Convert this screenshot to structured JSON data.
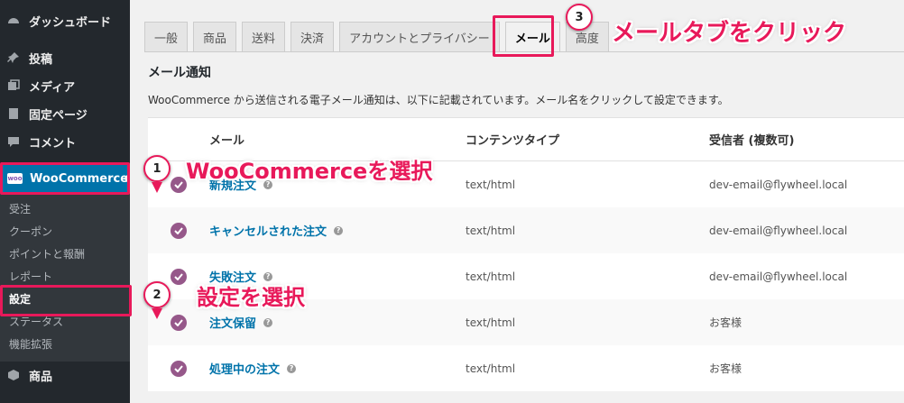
{
  "sidebar": {
    "items": [
      {
        "label": "ダッシュボード",
        "icon": "dashboard-icon"
      },
      {
        "label": "投稿",
        "icon": "pin-icon"
      },
      {
        "label": "メディア",
        "icon": "media-icon"
      },
      {
        "label": "固定ページ",
        "icon": "page-icon"
      },
      {
        "label": "コメント",
        "icon": "comment-icon"
      }
    ],
    "woocommerce": {
      "label": "WooCommerce",
      "logo_text": "woo"
    },
    "submenu": [
      "受注",
      "クーポン",
      "ポイントと報酬",
      "レポート",
      "設定",
      "ステータス",
      "機能拡張"
    ],
    "products": {
      "label": "商品",
      "icon": "products-icon"
    }
  },
  "tabs": [
    "一般",
    "商品",
    "送料",
    "決済",
    "アカウントとプライバシー",
    "メール",
    "高度"
  ],
  "active_tab": "メール",
  "section_title": "メール通知",
  "description": "WooCommerce から送信される電子メール通知は、以下に記載されています。メール名をクリックして設定できます。",
  "table": {
    "headers": [
      "メール",
      "コンテンツタイプ",
      "受信者 (複数可)"
    ],
    "rows": [
      {
        "name": "新規注文",
        "type": "text/html",
        "recipient": "dev-email@flywheel.local"
      },
      {
        "name": "キャンセルされた注文",
        "type": "text/html",
        "recipient": "dev-email@flywheel.local"
      },
      {
        "name": "失敗注文",
        "type": "text/html",
        "recipient": "dev-email@flywheel.local"
      },
      {
        "name": "注文保留",
        "type": "text/html",
        "recipient": "お客様"
      },
      {
        "name": "処理中の注文",
        "type": "text/html",
        "recipient": "お客様"
      }
    ],
    "help_glyph": "?"
  },
  "annotations": {
    "step1": {
      "number": "1",
      "text": "WooCommerceを選択"
    },
    "step2": {
      "number": "2",
      "text": "設定を選択"
    },
    "step3": {
      "number": "3",
      "text": "メールタブをクリック"
    }
  },
  "colors": {
    "accent": "#e8195a",
    "woo_purple": "#96588a",
    "wp_blue": "#0073aa",
    "sidebar": "#23282d"
  }
}
